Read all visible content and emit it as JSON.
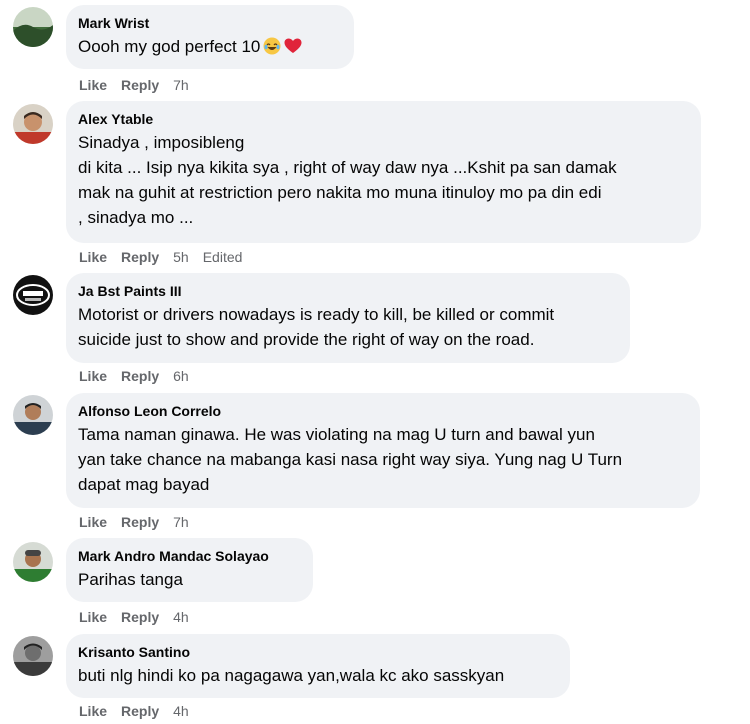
{
  "comments": [
    {
      "author": "Mark Wrist",
      "text": "Oooh my god perfect 10",
      "emoji": [
        "laughing-tears-emoji",
        "red-heart-emoji"
      ],
      "like": "Like",
      "reply": "Reply",
      "time": "7h",
      "edited": ""
    },
    {
      "author": "Alex Ytable",
      "text": "Sinadya , imposibleng\ndi kita ... Isip nya kikita sya , right of way daw nya ...Kshit pa san damak\nmak na guhit at restriction pero nakita mo muna itinuloy mo pa din edi\n, sinadya mo ...",
      "like": "Like",
      "reply": "Reply",
      "time": "5h",
      "edited": "Edited"
    },
    {
      "author": "Ja Bst Paints III",
      "text": "Motorist or drivers nowadays is ready to kill, be killed or commit\nsuicide just to show and provide the right of way on the road.",
      "like": "Like",
      "reply": "Reply",
      "time": "6h",
      "edited": ""
    },
    {
      "author": "Alfonso Leon Correlo",
      "text": "Tama naman ginawa. He was violating na mag U turn and bawal yun\nyan take chance na mabanga kasi nasa right way siya. Yung nag U Turn\ndapat mag bayad",
      "like": "Like",
      "reply": "Reply",
      "time": "7h",
      "edited": ""
    },
    {
      "author": "Mark Andro Mandac Solayao",
      "text": "Parihas tanga",
      "like": "Like",
      "reply": "Reply",
      "time": "4h",
      "edited": ""
    },
    {
      "author": "Krisanto Santino",
      "text": "buti nlg hindi ko pa nagagawa yan,wala kc ako sasskyan",
      "like": "Like",
      "reply": "Reply",
      "time": "4h",
      "edited": ""
    }
  ]
}
